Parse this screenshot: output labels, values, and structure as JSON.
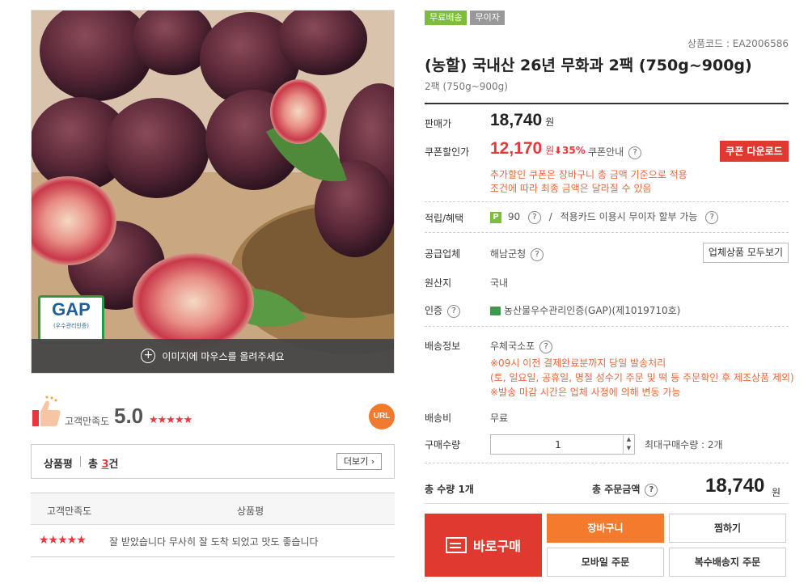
{
  "badges": [
    "무료배송",
    "무이자"
  ],
  "product": {
    "code": "상품코드 : EA2006586",
    "title": "(농할) 국내산 26년 무화과 2팩 (750g~900g)",
    "subtitle": "2팩 (750g~900g)"
  },
  "image": {
    "gap_text": "GAP",
    "gap_sub": "(우수관리인증)",
    "zoom_hint": "이미지에 마우스를 올려주세요"
  },
  "satisfaction": {
    "label": "고객만족도",
    "score": "5.0",
    "stars": "★★★★★",
    "url_label": "URL"
  },
  "reviews": {
    "title": "상품평",
    "total_prefix": "총 ",
    "total_count": "3",
    "total_suffix": "건",
    "more_label": "더보기 ›",
    "col_satisfaction": "고객만족도",
    "col_review": "상품평",
    "rows": [
      {
        "stars": "★★★★★",
        "comment": "잘 받았습니다 무사히 잘 도착 되었고 맛도 좋습니다"
      }
    ]
  },
  "price": {
    "sale_label": "판매가",
    "sale_value": "18,740",
    "won": "원",
    "coupon_label": "쿠폰할인가",
    "coupon_value": "12,170",
    "coupon_rate": "⬇35%",
    "coupon_info": "쿠폰안내",
    "coupon_button": "쿠폰 다운로드",
    "coupon_note_1": "추가할인 쿠폰은 장바구니 총 금액 기준으로 적용",
    "coupon_note_2": "조건에 따라 최종 금액은 달라질 수 있음"
  },
  "reward": {
    "label": "적립/혜택",
    "points": "90",
    "card_text": "적용카드 이용시 무이자 할부 가능"
  },
  "supplier": {
    "label": "공급업체",
    "value": "해남군청",
    "button": "업체상품 모두보기"
  },
  "origin": {
    "label": "원산지",
    "value": "국내"
  },
  "certification": {
    "label": "인증",
    "value": "농산물우수관리인증(GAP)(제1019710호)"
  },
  "shipping": {
    "label": "배송정보",
    "value": "우체국소포",
    "note_1": "※09시 이전 결제완료분까지 당일 발송처리",
    "note_2": "(토, 일요일, 공휴일, 명절 성수기 주문 및 떡 등 주문확인 후 제조상품 제외)",
    "note_3": "※발송 마감 시간은 업체 사정에 의해 변동 가능"
  },
  "shipping_fee": {
    "label": "배송비",
    "value": "무료"
  },
  "quantity": {
    "label": "구매수량",
    "value": "1",
    "max_text": "최대구매수량 : 2개"
  },
  "totals": {
    "qty_text": "총 수량 1개",
    "amount_label": "총 주문금액",
    "amount_value": "18,740",
    "won": "원"
  },
  "actions": {
    "buy_now": "바로구매",
    "cart": "장바구니",
    "wish": "찜하기",
    "mobile": "모바일 주문",
    "multi": "복수배송지 주문"
  },
  "colors": {
    "accent_red": "#e03a30",
    "accent_orange": "#f47a2e",
    "badge_green": "#7cbd3b"
  }
}
